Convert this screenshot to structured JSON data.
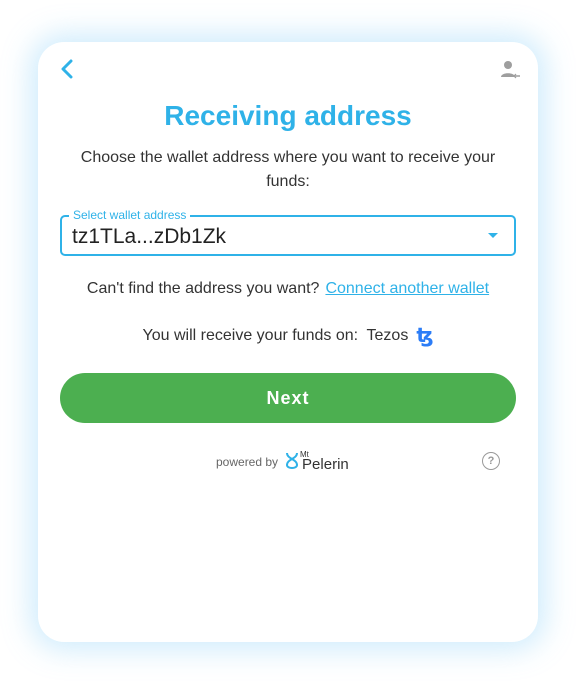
{
  "header": {
    "back_icon": "chevron-left-icon",
    "account_icon": "user-account-icon"
  },
  "title": "Receiving address",
  "subtitle": "Choose the wallet address where you want to receive your funds:",
  "wallet_select": {
    "label": "Select wallet address",
    "value": "tz1TLa...zDb1Zk"
  },
  "cant_find": {
    "text": "Can't find the address you want?",
    "link": "Connect another wallet"
  },
  "receive_on": {
    "text": "You will receive your funds on:",
    "network": "Tezos",
    "network_icon": "ꜩ"
  },
  "next_button": "Next",
  "footer": {
    "powered_by": "powered by",
    "brand_prefix": "Mt",
    "brand_name": "Pelerin",
    "help_label": "?"
  },
  "colors": {
    "accent": "#2fb2e8",
    "button": "#4caf50",
    "tezos": "#2c7df7"
  }
}
